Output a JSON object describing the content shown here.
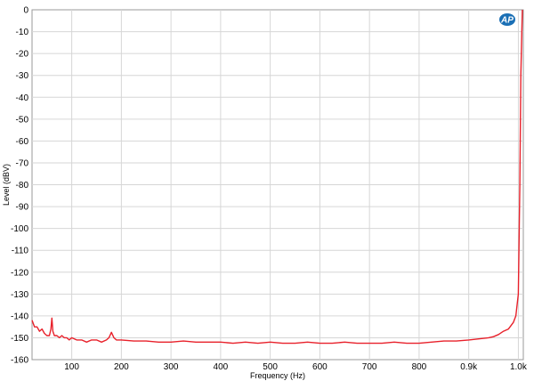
{
  "chart_data": {
    "type": "line",
    "xlabel": "Frequency (Hz)",
    "ylabel": "Level (dBV)",
    "xlim": [
      20,
      1010
    ],
    "ylim": [
      -160,
      0
    ],
    "grid": true,
    "x_ticks": [
      100,
      200,
      300,
      400,
      500,
      600,
      700,
      800,
      900,
      1000
    ],
    "x_tick_labels": [
      "100",
      "200",
      "300",
      "400",
      "500",
      "600",
      "700",
      "800",
      "0.9k",
      "1.0k"
    ],
    "y_ticks": [
      0,
      -10,
      -20,
      -30,
      -40,
      -50,
      -60,
      -70,
      -80,
      -90,
      -100,
      -110,
      -120,
      -130,
      -140,
      -150,
      -160
    ],
    "y_tick_labels": [
      "0",
      "-10",
      "-20",
      "-30",
      "-40",
      "-50",
      "-60",
      "-70",
      "-80",
      "-90",
      "-100",
      "-110",
      "-120",
      "-130",
      "-140",
      "-150",
      "-160"
    ],
    "series": [
      {
        "color": "#e8202a",
        "x": [
          20,
          25,
          30,
          35,
          40,
          45,
          50,
          55,
          58,
          60,
          62,
          65,
          70,
          75,
          80,
          85,
          90,
          95,
          100,
          110,
          120,
          130,
          140,
          150,
          160,
          170,
          175,
          180,
          185,
          190,
          200,
          225,
          250,
          275,
          300,
          325,
          350,
          375,
          400,
          425,
          450,
          475,
          500,
          525,
          550,
          575,
          600,
          625,
          650,
          675,
          700,
          725,
          750,
          775,
          800,
          825,
          850,
          875,
          900,
          920,
          940,
          950,
          960,
          970,
          980,
          990,
          995,
          1000,
          1003,
          1005,
          1008
        ],
        "y": [
          -142,
          -145,
          -145,
          -147,
          -146,
          -148,
          -149,
          -149,
          -146,
          -141,
          -147,
          -149,
          -149,
          -150,
          -149,
          -150,
          -150,
          -151,
          -150,
          -151,
          -151,
          -152,
          -151,
          -151,
          -152,
          -151,
          -150,
          -147.5,
          -150,
          -151,
          -151,
          -151.5,
          -151.5,
          -152,
          -152,
          -151.5,
          -152,
          -152,
          -152,
          -152.5,
          -152,
          -152.5,
          -152,
          -152.5,
          -152.5,
          -152,
          -152.5,
          -152.5,
          -152,
          -152.5,
          -152.5,
          -152.5,
          -152,
          -152.5,
          -152.5,
          -152,
          -151.5,
          -151.5,
          -151,
          -150.5,
          -150,
          -149.5,
          -148.5,
          -147,
          -146,
          -143,
          -140,
          -130,
          -80,
          -30,
          0
        ]
      }
    ]
  },
  "logo": {
    "text": "AP",
    "color": "#1a6fb5"
  }
}
